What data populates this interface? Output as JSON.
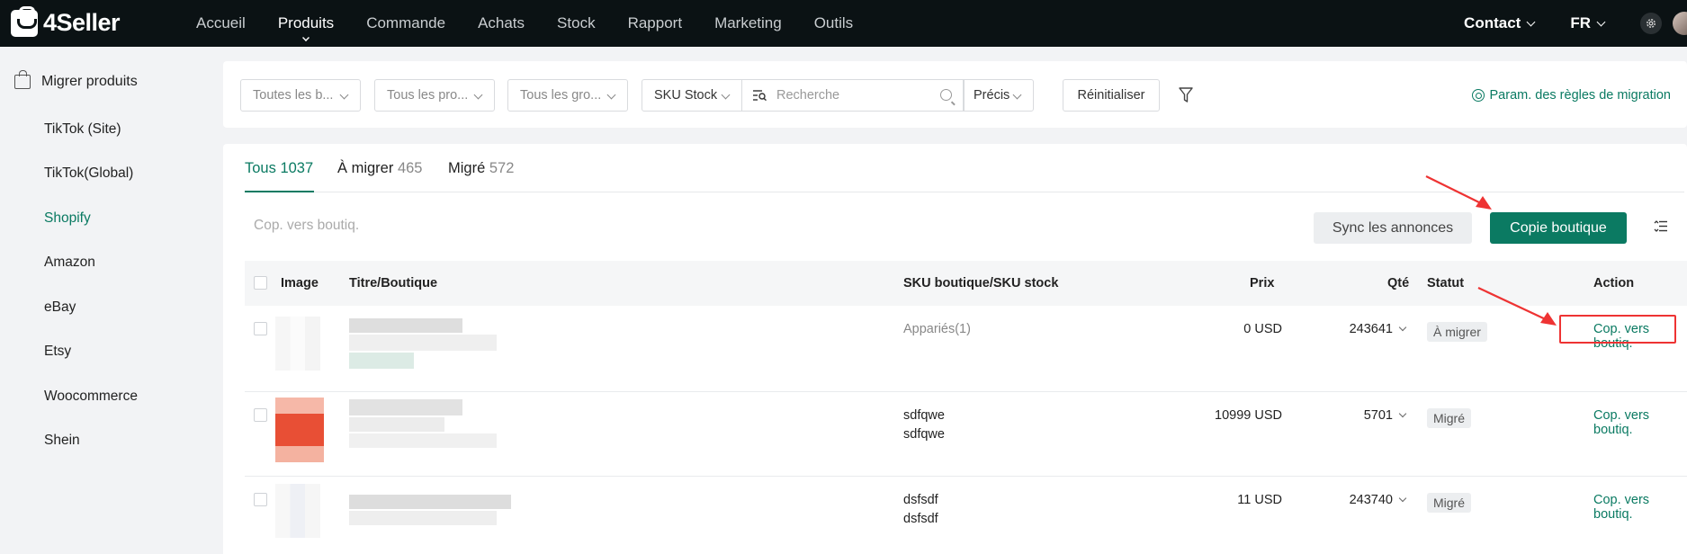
{
  "app": {
    "brand": "4Seller"
  },
  "nav": {
    "items": [
      "Accueil",
      "Produits",
      "Commande",
      "Achats",
      "Stock",
      "Rapport",
      "Marketing",
      "Outils"
    ],
    "active_index": 1,
    "contact": "Contact",
    "language": "FR"
  },
  "sidebar": {
    "heading": "Migrer produits",
    "items": [
      "TikTok (Site)",
      "TikTok(Global)",
      "Shopify",
      "Amazon",
      "eBay",
      "Etsy",
      "Woocommerce",
      "Shein"
    ],
    "active": "Shopify"
  },
  "filters": {
    "shop_select": "Toutes les b...",
    "product_select": "Tous les pro...",
    "group_select": "Tous les gro...",
    "sku_type": "SKU Stock",
    "search_placeholder": "Recherche",
    "match_mode": "Précis",
    "reset": "Réinitialiser",
    "migration_rules": "Param. des règles de migration"
  },
  "tabs": [
    {
      "label": "Tous",
      "count": "1037"
    },
    {
      "label": "À migrer",
      "count": "465"
    },
    {
      "label": "Migré",
      "count": "572"
    }
  ],
  "toolbar": {
    "bulk_action": "Cop. vers boutiq.",
    "sync": "Sync les annonces",
    "copy_shop": "Copie boutique"
  },
  "table": {
    "headers": [
      "Image",
      "Titre/Boutique",
      "SKU boutique/SKU stock",
      "Prix",
      "Qté",
      "Statut",
      "Action"
    ],
    "rows": [
      {
        "sku_line1": "Appariés(1)",
        "sku_line2": "",
        "price": "0 USD",
        "qty": "243641",
        "status": "À migrer",
        "action": "Cop. vers boutiq."
      },
      {
        "sku_line1": "sdfqwe",
        "sku_line2": "sdfqwe",
        "price": "10999 USD",
        "qty": "5701",
        "status": "Migré",
        "action": "Cop. vers boutiq."
      },
      {
        "sku_line1": "dsfsdf",
        "sku_line2": "dsfsdf",
        "price": "11 USD",
        "qty": "243740",
        "status": "Migré",
        "action": "Cop. vers boutiq."
      }
    ]
  },
  "colors": {
    "accent": "#0a7a62",
    "topbar": "#0b1214",
    "annotation": "#e33333"
  }
}
